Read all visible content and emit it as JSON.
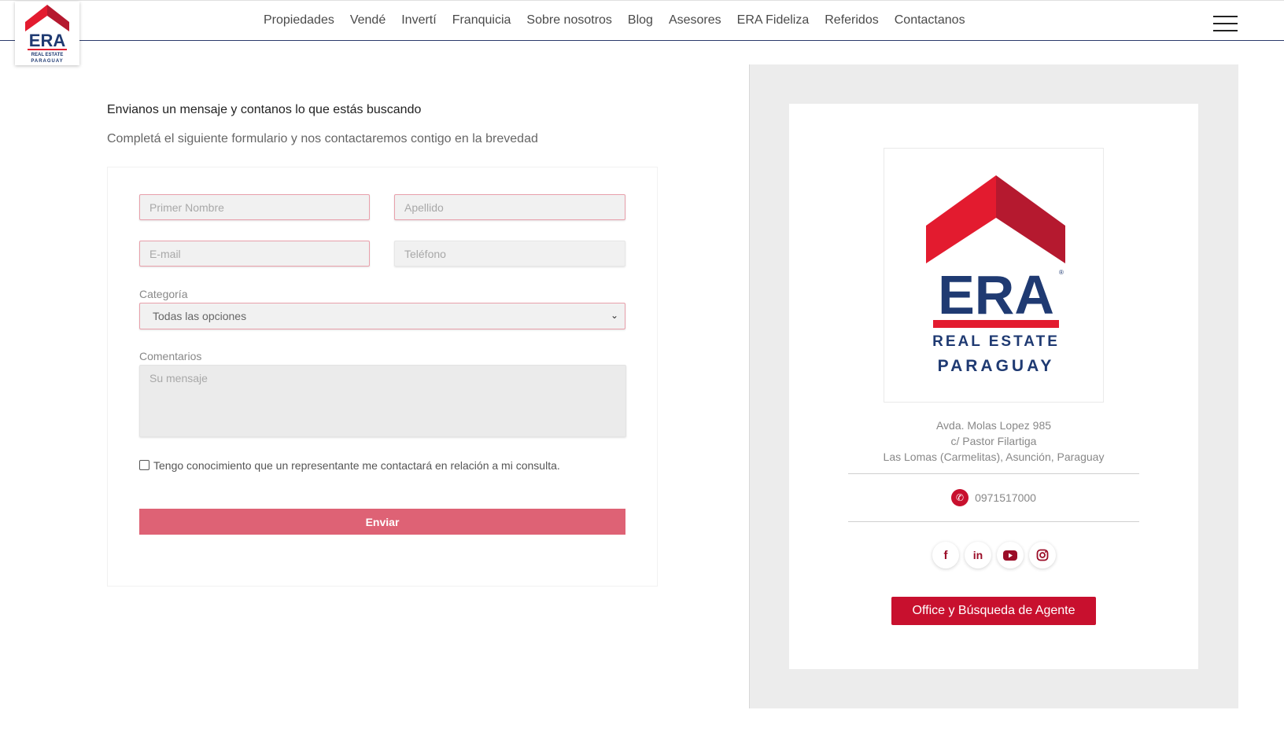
{
  "brand": {
    "name": "ERA",
    "line1": "REAL ESTATE",
    "line2": "PARAGUAY",
    "colors": {
      "red": "#e31b2f",
      "dark_red": "#b5192f",
      "navy": "#1f3a72",
      "button_pink": "#de6275",
      "accent": "#c8102e"
    }
  },
  "nav": {
    "items": [
      "Propiedades",
      "Vendé",
      "Invertí",
      "Franquicia",
      "Sobre nosotros",
      "Blog",
      "Asesores",
      "ERA Fideliza",
      "Referidos",
      "Contactanos"
    ],
    "menu_icon": "hamburger-icon"
  },
  "form": {
    "title": "Envianos un mensaje y contanos lo que estás buscando",
    "subtitle": "Completá el siguiente formulario y nos contactaremos contigo en la brevedad",
    "first_name_placeholder": "Primer Nombre",
    "last_name_placeholder": "Apellido",
    "email_placeholder": "E-mail",
    "phone_placeholder": "Teléfono",
    "category_label": "Categoría",
    "category_value": "Todas las opciones",
    "comments_label": "Comentarios",
    "comments_placeholder": "Su mensaje",
    "consent_text": "Tengo conocimiento que un representante me contactará en relación a mi consulta.",
    "submit_label": "Enviar"
  },
  "office": {
    "address_line1": "Avda. Molas Lopez 985",
    "address_line2": "c/ Pastor Filartiga",
    "address_line3": "Las Lomas (Carmelitas), Asunción, Paraguay",
    "phone": "0971517000",
    "social": [
      "facebook-icon",
      "linkedin-icon",
      "youtube-icon",
      "instagram-icon"
    ],
    "office_button": "Office y Búsqueda de Agente"
  }
}
